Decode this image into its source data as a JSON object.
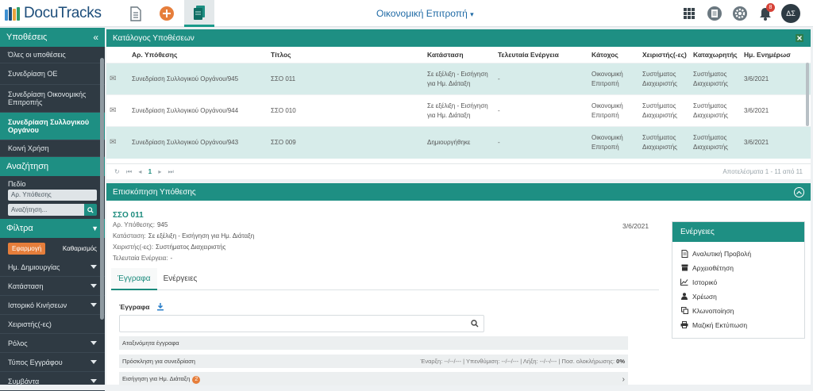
{
  "app": {
    "logo_text": "DocuTracks",
    "org_selector": "Οικονομική Επιτροπή",
    "notifications_count": "8",
    "user_initials": "ΔΣ"
  },
  "sidebar": {
    "header_title": "Υποθέσεις",
    "collapse_icon": "«",
    "items": [
      {
        "label": "Όλες οι υποθέσεις",
        "active": false
      },
      {
        "label": "Συνεδρίαση ΟΕ",
        "active": false
      },
      {
        "label": "Συνεδρίαση Οικονομικής Επιτροπής",
        "active": false
      },
      {
        "label": "Συνεδρίαση Συλλογικού Οργάνου",
        "active": true
      },
      {
        "label": "Κοινή Χρήση",
        "active": false
      }
    ],
    "search_header": "Αναζήτηση",
    "field_label": "Πεδίο",
    "field_value": "Αρ. Υπόθεσης",
    "search_placeholder": "Αναζήτηση...",
    "filters_header": "Φίλτρα",
    "apply_label": "Εφαρμογή",
    "clear_label": "Καθαρισμός",
    "filters": [
      "Ημ. Δημιουργίας",
      "Κατάσταση",
      "Ιστορικό Κινήσεων",
      "Χειριστής(-ες)",
      "Ρόλος",
      "Τύπος Εγγράφου",
      "Συμβάντα"
    ]
  },
  "list": {
    "title": "Κατάλογος Υποθέσεων",
    "columns": [
      "",
      "Αρ. Υπόθεσης",
      "Τίτλος",
      "Κατάσταση",
      "Τελευταία Ενέργεια",
      "Κάτοχος",
      "Χειριστής(-ες)",
      "Καταχωρητής",
      "Ημ. Ενημέρωσ"
    ],
    "rows": [
      {
        "number": "Συνεδρίαση Συλλογικού Οργάνου/945",
        "title": "ΣΣΟ 011",
        "status": "Σε εξέλιξη - Εισήγηση για Ημ. Διάταξη",
        "last_action": "-",
        "owner": "Οικονομική Επιτροπή",
        "handler": "Συστήματος Διαχειριστής",
        "registrar": "Συστήματος Διαχειριστής",
        "updated": "3/6/2021",
        "highlight": true
      },
      {
        "number": "Συνεδρίαση Συλλογικού Οργάνου/944",
        "title": "ΣΣΟ 010",
        "status": "Σε εξέλιξη - Εισήγηση για Ημ. Διάταξη",
        "last_action": "-",
        "owner": "Οικονομική Επιτροπή",
        "handler": "Συστήματος Διαχειριστής",
        "registrar": "Συστήματος Διαχειριστής",
        "updated": "3/6/2021",
        "highlight": false
      },
      {
        "number": "Συνεδρίαση Συλλογικού Οργάνου/943",
        "title": "ΣΣΟ 009",
        "status": "Δημιουργήθηκε",
        "last_action": "-",
        "owner": "Οικονομική Επιτροπή",
        "handler": "Συστήματος Διαχειριστής",
        "registrar": "Συστήματος Διαχειριστής",
        "updated": "3/6/2021",
        "highlight": true
      }
    ],
    "page_current": "1",
    "results_text": "Αποτελέσματα 1 - 11 από 11"
  },
  "overview": {
    "title": "Επισκόπηση Υπόθεσης",
    "case_title": "ΣΣΟ 011",
    "number_label": "Αρ. Υπόθεσης:",
    "number_value": "945",
    "status_label": "Κατάσταση:",
    "status_value": "Σε εξέλιξη - Εισήγηση για Ημ. Διάταξη",
    "handler_label": "Χειριστής(-ες):",
    "handler_value": "Συστήματος Διαχειριστής",
    "last_action_label": "Τελευταία Ενέργεια:",
    "last_action_value": "-",
    "date": "3/6/2021",
    "tabs": [
      "Έγγραφα",
      "Ενέργειες"
    ],
    "docs_label": "Έγγραφα",
    "unassigned_docs": "Αταξινόμητα έγγραφα",
    "doc1_title": "Πρόσκληση για συνεδρίαση",
    "doc1_meta_start": "Έναρξη: --/--/---",
    "doc1_meta_reminder": "Υπενθύμιση: --/--/---",
    "doc1_meta_end": "Λήξη: --/--/---",
    "doc1_meta_pct_label": "Ποσ. ολοκλήρωσης:",
    "doc1_meta_pct": "0%",
    "doc2_title": "Εισήγηση για Ημ. Διάταξη",
    "doc2_badge": "2"
  },
  "actions": {
    "header": "Ενέργειες",
    "items": [
      {
        "label": "Αναλυτική Προβολή",
        "icon": "document-icon"
      },
      {
        "label": "Αρχειοθέτηση",
        "icon": "archive-icon"
      },
      {
        "label": "Ιστορικό",
        "icon": "chart-line-icon"
      },
      {
        "label": "Χρέωση",
        "icon": "user-icon"
      },
      {
        "label": "Κλωνοποίηση",
        "icon": "copy-icon"
      },
      {
        "label": "Μαζική Εκτύπωση",
        "icon": "print-icon"
      }
    ]
  },
  "colors": {
    "accent": "#1e8f83",
    "sidebar": "#2f3a43",
    "orange": "#e67e3b",
    "link": "#1f6aa5"
  }
}
